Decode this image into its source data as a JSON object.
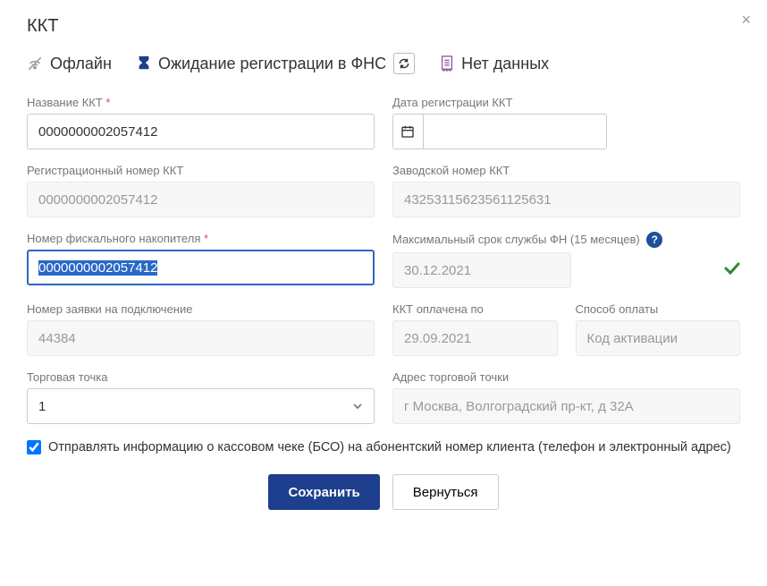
{
  "title": "ККТ",
  "status": {
    "offline": "Офлайн",
    "waiting": "Ожидание регистрации в ФНС",
    "nodata": "Нет данных"
  },
  "labels": {
    "name": "Название ККТ",
    "regDate": "Дата регистрации ККТ",
    "regNum": "Регистрационный номер ККТ",
    "serialNum": "Заводской номер ККТ",
    "fnNum": "Номер фискального накопителя",
    "fnExpiry": "Максимальный срок службы ФН (15 месяцев)",
    "reqNum": "Номер заявки на подключение",
    "paidUntil": "ККТ оплачена по",
    "payMethod": "Способ оплаты",
    "tradePoint": "Торговая точка",
    "tradeAddr": "Адрес торговой точки"
  },
  "values": {
    "name": "0000000002057412",
    "regDate": "",
    "regNum": "0000000002057412",
    "serialNum": "43253115623561125631",
    "fnNum": "0000000002057412",
    "fnExpiry": "30.12.2021",
    "reqNum": "44384",
    "paidUntil": "29.09.2021",
    "payMethod": "Код активации",
    "tradePoint": "1",
    "tradeAddr": "г Москва, Волгоградский пр-кт, д 32А"
  },
  "checkbox": "Отправлять информацию о кассовом чеке (БСО) на абонентский номер клиента (телефон и электронный адрес)",
  "buttons": {
    "save": "Сохранить",
    "back": "Вернуться"
  }
}
